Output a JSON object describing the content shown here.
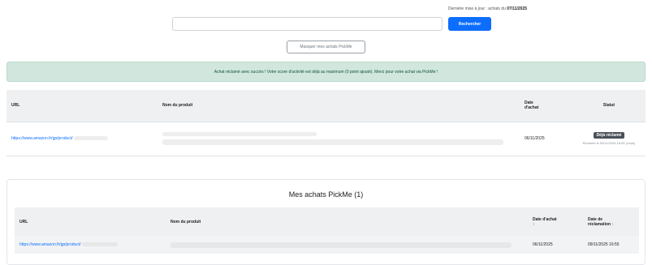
{
  "header": {
    "last_update_prefix": "Dernière mise à jour : achats du",
    "last_update_date": "07/11/2025"
  },
  "search": {
    "input_value": "",
    "button_label": "Rechercher"
  },
  "toggle": {
    "label": "Masquer mes achats PickMe"
  },
  "alert": {
    "message": "Achat réclamé avec succès ! Votre score d'activité est déjà au maximum (0 point ajouté). Merci pour votre achat via PickMe !"
  },
  "search_results": {
    "columns": {
      "url": "URL",
      "product": "Nom du produit",
      "date_line1": "Date",
      "date_line2": "d'achat",
      "status": "Statut"
    },
    "rows": [
      {
        "url": "https://www.amazon.fr/gp/product/",
        "product": "",
        "date": "06/11/2025",
        "status_badge": "Déjà réclamé",
        "claim_note": "Réclamé le 09/11/2025 16:55 (Vous)"
      }
    ]
  },
  "my_purchases": {
    "title": "Mes achats PickMe (1)",
    "columns": {
      "url": "URL",
      "product": "Nom du produit",
      "purchase_date": "Date d'achat",
      "claim_date_line1": "Date de",
      "claim_date_line2": "réclamation"
    },
    "sort_glyph": "↕",
    "rows": [
      {
        "url": "https://www.amazon.fr/gp/product/",
        "product": "",
        "purchase_date": "06/11/2025",
        "claim_date": "09/11/2025 16:55"
      }
    ]
  },
  "colors": {
    "primary": "#0d6efd",
    "success_bg": "#d1e7dd",
    "badge_bg": "#495057"
  }
}
